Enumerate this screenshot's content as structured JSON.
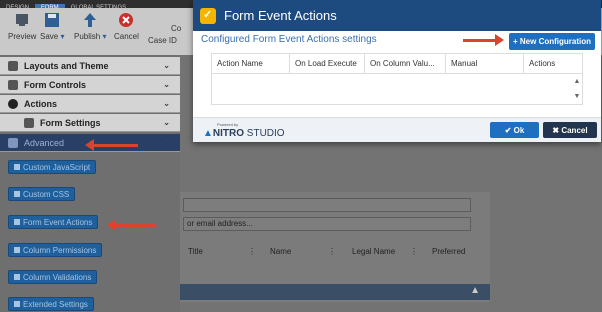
{
  "app": {
    "tabs": [
      "DESIGN",
      "FORM",
      "GLOBAL SETTINGS"
    ],
    "ribbon": {
      "preview": "Preview",
      "save": "Save",
      "publish": "Publish",
      "cancel": "Cancel",
      "case_id": "Case ID",
      "co_fragment": "Co"
    },
    "sidebar": {
      "sections": [
        "Layouts and Theme",
        "Form Controls",
        "Actions",
        "Form Settings",
        "Advanced"
      ],
      "advanced_items": [
        "Custom JavaScript",
        "Custom CSS",
        "Form Event Actions",
        "Column Permissions",
        "Column Validations",
        "Extended Settings"
      ]
    },
    "background": {
      "email_placeholder": "or email address...",
      "columns": [
        "Title",
        "Name",
        "Legal Name",
        "Preferred"
      ]
    }
  },
  "modal": {
    "title": "Form Event Actions",
    "subtitle": "Configured Form Event Actions settings",
    "new_button": "+ New Configuration",
    "columns": [
      "Action Name",
      "On Load Execute",
      "On Column Valu...",
      "Manual",
      "Actions"
    ],
    "footer": {
      "powered_by": "Powered by",
      "brand": "NITRO",
      "brand_suffix": "STUDIO",
      "ok": "✔ Ok",
      "cancel": "✖ Cancel"
    }
  },
  "colors": {
    "header": "#1d4b80",
    "primary": "#1f6fc0",
    "arrow": "#d9452b"
  }
}
